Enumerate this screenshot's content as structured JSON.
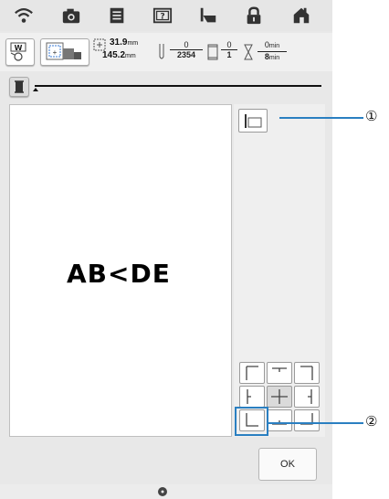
{
  "header": {
    "icons": [
      "wifi-icon",
      "camera-icon",
      "document-icon",
      "help-icon",
      "thread-icon",
      "lock-icon",
      "home-icon"
    ],
    "help_label": "?"
  },
  "info": {
    "width_value": "31.9",
    "height_value": "145.2",
    "unit_mm": "mm",
    "stitch_current": "0",
    "stitch_total": "2354",
    "color_current": "0",
    "color_total": "1",
    "time_current": "0",
    "time_total": "8",
    "unit_min": "min"
  },
  "pattern_text": "AB<DE",
  "ok_label": "OK",
  "callouts": [
    "①",
    "②"
  ],
  "accent_color": "#2a7fc1"
}
